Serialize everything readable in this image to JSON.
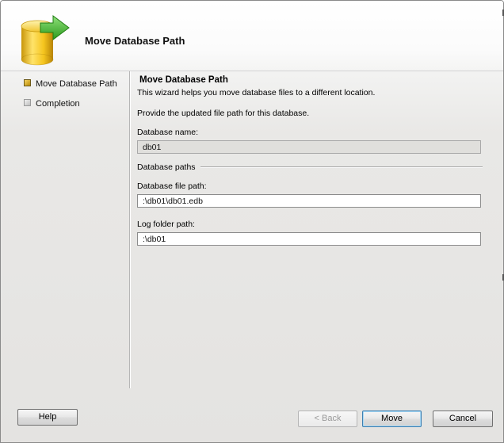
{
  "header": {
    "title": "Move Database Path",
    "icon": "database-move-icon"
  },
  "nav": {
    "items": [
      {
        "label": "Move Database Path",
        "state": "active"
      },
      {
        "label": "Completion",
        "state": "inactive"
      }
    ]
  },
  "content": {
    "title": "Move Database Path",
    "description": "This wizard helps you move database files to a different location.",
    "instruction": "Provide the updated file path for this database.",
    "database_name_label": "Database name:",
    "database_name_value": "db01",
    "section_title": "Database paths",
    "file_path_label": "Database file path:",
    "file_path_value": ":\\db01\\db01.edb",
    "log_path_label": "Log folder path:",
    "log_path_value": ":\\db01"
  },
  "footer": {
    "help_label": "Help",
    "back_label": "< Back",
    "move_label": "Move",
    "cancel_label": "Cancel"
  },
  "colors": {
    "accent_green": "#3fae2a",
    "db_yellow": "#f2c318",
    "bullet_active": "#d9a91a"
  }
}
